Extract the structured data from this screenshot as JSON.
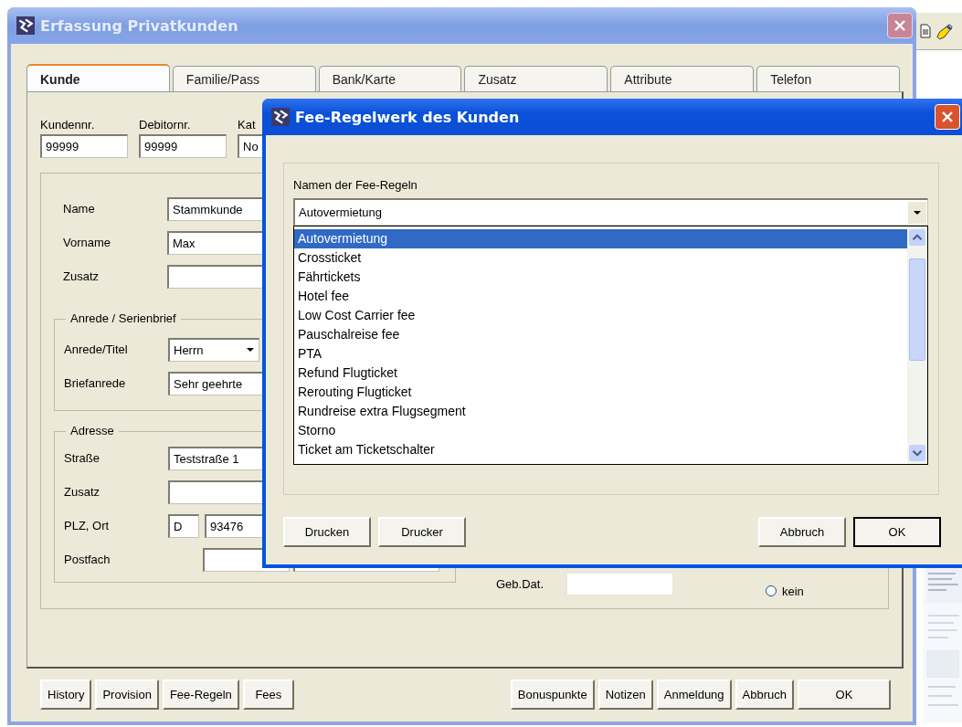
{
  "main_window": {
    "title": "Erfassung Privatkunden",
    "active": false,
    "tabs": [
      {
        "label": "Kunde",
        "selected": true
      },
      {
        "label": "Familie/Pass",
        "selected": false
      },
      {
        "label": "Bank/Karte",
        "selected": false
      },
      {
        "label": "Zusatz",
        "selected": false
      },
      {
        "label": "Attribute",
        "selected": false
      },
      {
        "label": "Telefon",
        "selected": false
      }
    ],
    "header_fields": [
      {
        "label": "Kundennr.",
        "value": "99999"
      },
      {
        "label": "Debitornr.",
        "value": "99999"
      },
      {
        "label": "Kat",
        "value": "No"
      }
    ],
    "person_fields": [
      {
        "label": "Name",
        "value": "Stammkunde"
      },
      {
        "label": "Vorname",
        "value": "Max"
      },
      {
        "label": "Zusatz"
      }
    ],
    "anrede_group": {
      "title": "Anrede / Serienbrief",
      "fields": [
        {
          "label": "Anrede/Titel",
          "value": "Herrn",
          "kind": "combo"
        },
        {
          "label": "Briefanrede",
          "value": "Sehr geehrte",
          "kind": "text"
        }
      ]
    },
    "adresse_group": {
      "title": "Adresse",
      "fields": [
        {
          "label": "Straße",
          "value": "Teststraße 1",
          "kind": "text"
        },
        {
          "label": "Zusatz",
          "kind": "text"
        },
        {
          "label": "PLZ, Ort",
          "country": "D",
          "value": "93476",
          "kind": "plz"
        },
        {
          "label": "Postfach",
          "kind": "postfach"
        }
      ]
    },
    "birth_date": {
      "label": "Geb.Dat."
    },
    "gender_option": {
      "label": "kein",
      "selected": false
    },
    "buttons": [
      {
        "label": "History",
        "default": false
      },
      {
        "label": "Provision",
        "default": false
      },
      {
        "label": "Fee-Regeln",
        "default": false
      },
      {
        "label": "Fees",
        "default": false
      },
      {
        "label": "Bonuspunkte",
        "default": false
      },
      {
        "label": "Notizen",
        "default": false
      },
      {
        "label": "Anmeldung",
        "default": false
      },
      {
        "label": "Abbruch",
        "default": false
      },
      {
        "label": "OK",
        "default": false
      }
    ]
  },
  "dialog": {
    "title": "Fee-Regelwerk des Kunden",
    "active": true,
    "list_label": "Namen der Fee-Regeln",
    "combo_value": "Autovermietung",
    "items": [
      {
        "label": "Autovermietung",
        "selected": true
      },
      {
        "label": "Crossticket",
        "selected": false
      },
      {
        "label": "Fährtickets",
        "selected": false
      },
      {
        "label": "Hotel fee",
        "selected": false
      },
      {
        "label": "Low Cost Carrier fee",
        "selected": false
      },
      {
        "label": "Pauschalreise fee",
        "selected": false
      },
      {
        "label": "PTA",
        "selected": false
      },
      {
        "label": "Refund Flugticket",
        "selected": false
      },
      {
        "label": "Rerouting Flugticket",
        "selected": false
      },
      {
        "label": "Rundreise extra Flugsegment",
        "selected": false
      },
      {
        "label": "Storno",
        "selected": false
      },
      {
        "label": "Ticket am Ticketschalter",
        "selected": false
      }
    ],
    "left_buttons": [
      {
        "label": "Drucken",
        "default": false
      },
      {
        "label": "Drucker",
        "default": false
      }
    ],
    "right_buttons": [
      {
        "label": "Abbruch",
        "default": false
      },
      {
        "label": "OK",
        "default": true
      }
    ]
  }
}
